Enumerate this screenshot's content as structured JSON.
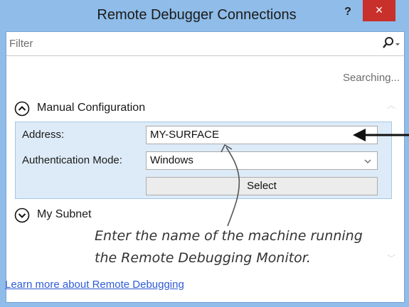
{
  "window": {
    "title": "Remote Debugger Connections",
    "help_label": "?",
    "close_label": "×"
  },
  "filter": {
    "placeholder": "Filter"
  },
  "status": {
    "text": "Searching..."
  },
  "manual": {
    "label": "Manual Configuration",
    "address_label": "Address:",
    "address_value": "MY-SURFACE",
    "auth_label": "Authentication Mode:",
    "auth_value": "Windows",
    "select_label": "Select"
  },
  "subnet": {
    "label": "My Subnet"
  },
  "annotation": {
    "line1": "Enter the name of the machine running",
    "line2": "the Remote Debugging Monitor."
  },
  "footer": {
    "link": "Learn more about Remote Debugging"
  },
  "icons": {
    "search": "search-icon",
    "collapse": "chevron-up-icon",
    "expand": "chevron-down-icon",
    "dropdown": "chevron-down-icon"
  }
}
